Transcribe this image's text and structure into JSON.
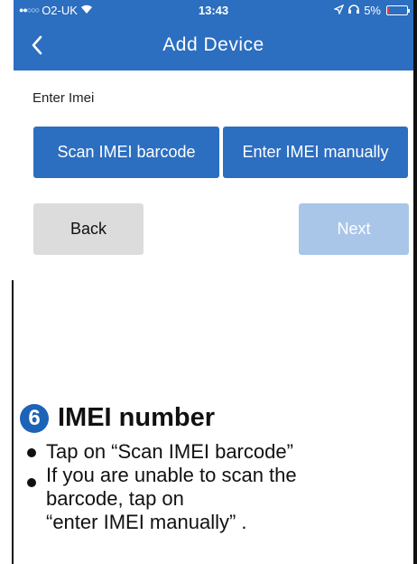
{
  "status_bar": {
    "carrier": "O2-UK",
    "time": "13:43",
    "battery": "5%",
    "wifi_icon": "wifi-icon",
    "location_icon": "location-arrow-icon"
  },
  "nav": {
    "title": "Add Device",
    "back_icon": "chevron-left-icon"
  },
  "form": {
    "label": "Enter Imei",
    "scan_button": "Scan IMEI barcode",
    "manual_button": "Enter IMEI manually",
    "back_button": "Back",
    "next_button": "Next"
  },
  "instructions": {
    "step_number": "6",
    "heading": "IMEI number",
    "bullets": [
      "Tap on “Scan IMEI barcode”",
      "If you are unable to scan the\nbarcode, tap on\n“enter IMEI manually” ."
    ]
  },
  "colors": {
    "primary": "#2c6ec0",
    "disabled": "#a9c6e9",
    "secondary": "#dcdcdc"
  }
}
